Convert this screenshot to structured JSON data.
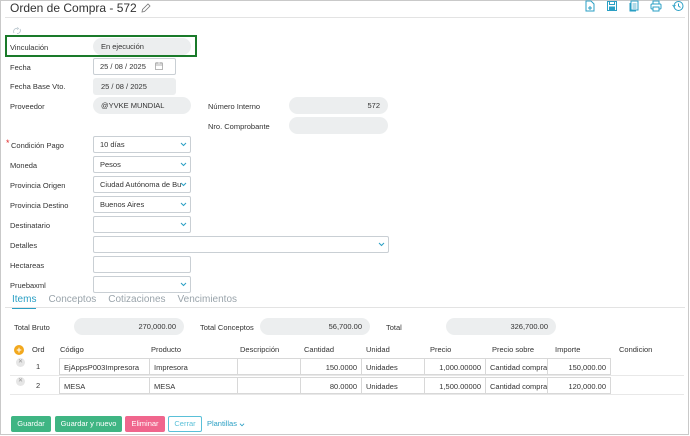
{
  "header": {
    "title": "Orden de Compra - 572",
    "icons": [
      "pencil-icon",
      "new-doc-icon",
      "save-icon",
      "copy-icon",
      "print-icon",
      "history-icon"
    ]
  },
  "form": {
    "vinculacion": {
      "label": "Vinculación",
      "value": "En ejecución"
    },
    "fecha": {
      "label": "Fecha",
      "day": "25",
      "month": "08",
      "year": "2025"
    },
    "fecha_base": {
      "label": "Fecha Base Vto.",
      "day": "25",
      "month": "08",
      "year": "2025"
    },
    "proveedor": {
      "label": "Proveedor",
      "value": "@YVKE MUNDIAL"
    },
    "numero_interno": {
      "label": "Número Interno",
      "value": "572"
    },
    "nro_comprobante": {
      "label": "Nro. Comprobante",
      "value": ""
    },
    "condicion_pago": {
      "label": "Condición Pago",
      "value": "10 días",
      "required": "*"
    },
    "moneda": {
      "label": "Moneda",
      "value": "Pesos"
    },
    "provincia_origen": {
      "label": "Provincia Origen",
      "value": "Ciudad Autónoma de Bu"
    },
    "provincia_destino": {
      "label": "Provincia Destino",
      "value": "Buenos Aires"
    },
    "destinatario": {
      "label": "Destinatario",
      "value": ""
    },
    "detalles": {
      "label": "Detalles",
      "value": ""
    },
    "hectareas": {
      "label": "Hectareas",
      "value": ""
    },
    "pruebaxml": {
      "label": "Pruebaxml",
      "value": ""
    }
  },
  "tabs": [
    {
      "label": "Items",
      "active": true
    },
    {
      "label": "Conceptos"
    },
    {
      "label": "Cotizaciones"
    },
    {
      "label": "Vencimientos"
    }
  ],
  "totals": {
    "bruto": {
      "label": "Total Bruto",
      "value": "270,000.00"
    },
    "conceptos": {
      "label": "Total Conceptos",
      "value": "56,700.00"
    },
    "total": {
      "label": "Total",
      "value": "326,700.00"
    }
  },
  "items_table": {
    "columns": [
      "Ord",
      "Código",
      "Producto",
      "Descripción",
      "Cantidad",
      "Unidad",
      "Precio",
      "Precio sobre",
      "Importe",
      "Condicion"
    ],
    "rows": [
      {
        "ord": "1",
        "codigo": "EjAppsP003Impresora",
        "producto": "Impresora",
        "descripcion": "",
        "cantidad": "150.0000",
        "unidad": "Unidades",
        "precio": "1,000.00000",
        "precio_sobre": "Cantidad compra",
        "importe": "150,000.00",
        "condicion": ""
      },
      {
        "ord": "2",
        "codigo": "MESA",
        "producto": "MESA",
        "descripcion": "",
        "cantidad": "80.0000",
        "unidad": "Unidades",
        "precio": "1,500.00000",
        "precio_sobre": "Cantidad compra",
        "importe": "120,000.00",
        "condicion": ""
      }
    ]
  },
  "buttons": {
    "guardar": "Guardar",
    "guardar_nuevo": "Guardar y nuevo",
    "eliminar": "Eliminar",
    "cerrar": "Cerrar",
    "plantillas": "Plantillas"
  },
  "colors": {
    "accent": "#2a9fc4",
    "green": "#3fb583",
    "red": "#f0668d",
    "highlight": "#1a7a2a",
    "add": "#f2a81d"
  }
}
